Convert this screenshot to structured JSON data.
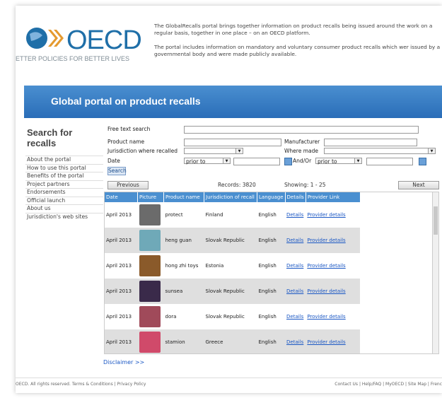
{
  "logo": {
    "text": "OECD",
    "tagline": "ETTER POLICIES FOR BETTER LIVES"
  },
  "intro": {
    "p1": "The GlobalRecalls portal brings together information on product recalls being issued around the work on a regular basis, together in one place – on an OECD platform.",
    "p2": "The portal includes information on mandatory and voluntary consumer product recalls which wer issued by a governmental body and were made publicly available."
  },
  "banner": {
    "title": "Global portal on product recalls"
  },
  "sidebar": {
    "title": "Search for recalls",
    "items": [
      "About the portal",
      "How to use this portal",
      "Benefits of the portal",
      "Project partners",
      "Endorsements",
      "Official launch",
      "About us",
      "Jurisdiction's web sites"
    ]
  },
  "form": {
    "free_text": "Free text search",
    "product_name": "Product name",
    "manufacturer": "Manufacturer",
    "jurisdiction": "Jurisdiction where recalled",
    "where_made": "Where made",
    "date": "Date",
    "date_op1": "prior to",
    "and_or": "And/Or",
    "date_op2": "prior to",
    "search": "Search"
  },
  "pager": {
    "previous": "Previous",
    "records": "Records: 3820",
    "showing": "Showing: 1 - 25",
    "next": "Next"
  },
  "table": {
    "headers": [
      "Date",
      "Picture",
      "Product name",
      "Jurisdiction of recall",
      "Language",
      "Details",
      "Provider Link"
    ],
    "rows": [
      {
        "date": "April 2013",
        "product": "protect",
        "jurisdiction": "Finland",
        "language": "English",
        "details": "Details",
        "provider": "Provider details",
        "color": "#6b6b6b"
      },
      {
        "date": "April 2013",
        "product": "heng guan",
        "jurisdiction": "Slovak Republic",
        "language": "English",
        "details": "Details",
        "provider": "Provider details",
        "color": "#6fa9b8"
      },
      {
        "date": "April 2013",
        "product": "hong zhi toys",
        "jurisdiction": "Estonia",
        "language": "English",
        "details": "Details",
        "provider": "Provider details",
        "color": "#8a5a2a"
      },
      {
        "date": "April 2013",
        "product": "sunsea",
        "jurisdiction": "Slovak Republic",
        "language": "English",
        "details": "Details",
        "provider": "Provider details",
        "color": "#3a2a4a"
      },
      {
        "date": "April 2013",
        "product": "dora",
        "jurisdiction": "Slovak Republic",
        "language": "English",
        "details": "Details",
        "provider": "Provider details",
        "color": "#a04a5a"
      },
      {
        "date": "April 2013",
        "product": "stamion",
        "jurisdiction": "Greece",
        "language": "English",
        "details": "Details",
        "provider": "Provider details",
        "color": "#d04a6a"
      }
    ]
  },
  "disclaimer": "Disclaimer >>",
  "footer": {
    "copyright": "OECD. All rights reserved.",
    "links_left": "Terms & Conditions | Privacy Policy",
    "links_right": "Contact Us | Help/FAQ | MyOECD | Site Map | Frenc"
  },
  "colors": {
    "banner": "#2a6db8",
    "header": "#4a8fd0",
    "link": "#1a57c4"
  }
}
